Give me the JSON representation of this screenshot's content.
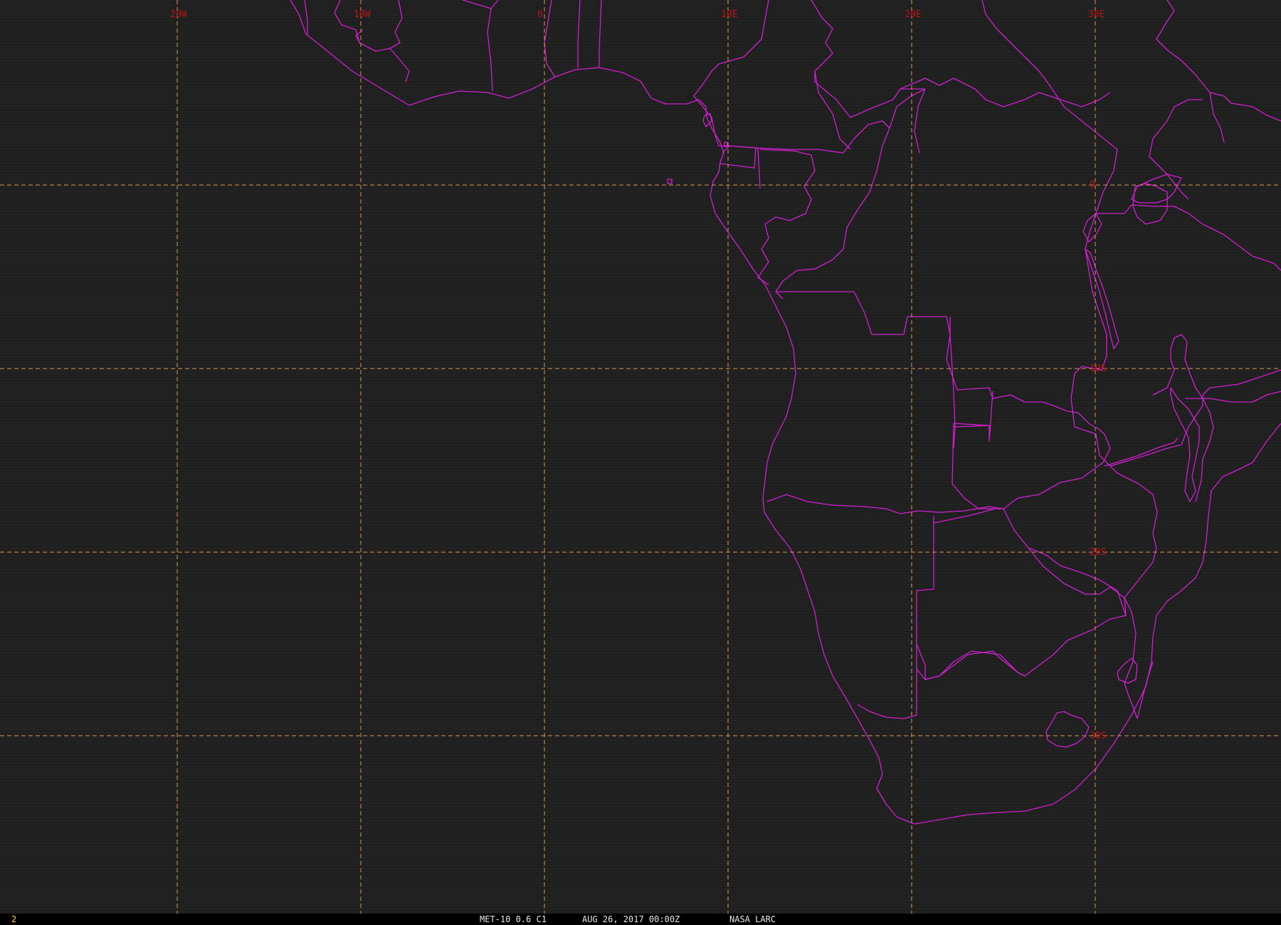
{
  "status_bar": {
    "frame_number": "2",
    "product": "MET-10 0.6 C1",
    "timestamp": "AUG 26, 2017 00:00Z",
    "source": "NASA LARC"
  },
  "grid": {
    "longitudes": [
      {
        "label": "20W",
        "lon": -20
      },
      {
        "label": "10W",
        "lon": -10
      },
      {
        "label": "0",
        "lon": 0
      },
      {
        "label": "10E",
        "lon": 10
      },
      {
        "label": "20E",
        "lon": 20
      },
      {
        "label": "30E",
        "lon": 30
      }
    ],
    "latitudes": [
      {
        "label": "0",
        "lat": 0
      },
      {
        "label": "10S",
        "lat": -10
      },
      {
        "label": "20S",
        "lat": -20
      },
      {
        "label": "30S",
        "lat": -30
      }
    ]
  },
  "colors": {
    "background": "#1c1c1c",
    "boundary": "#d020d0",
    "graticule": "#d8965a",
    "grid_label": "#b81414",
    "status_bar_bg": "#000000",
    "status_text": "#e8e8e8",
    "frame_number_text": "#ffd020"
  },
  "map": {
    "projection": "equirectangular",
    "lon_range": [
      -30,
      40
    ],
    "lat_range": [
      -38,
      10
    ],
    "features": "African coastlines and national borders"
  }
}
